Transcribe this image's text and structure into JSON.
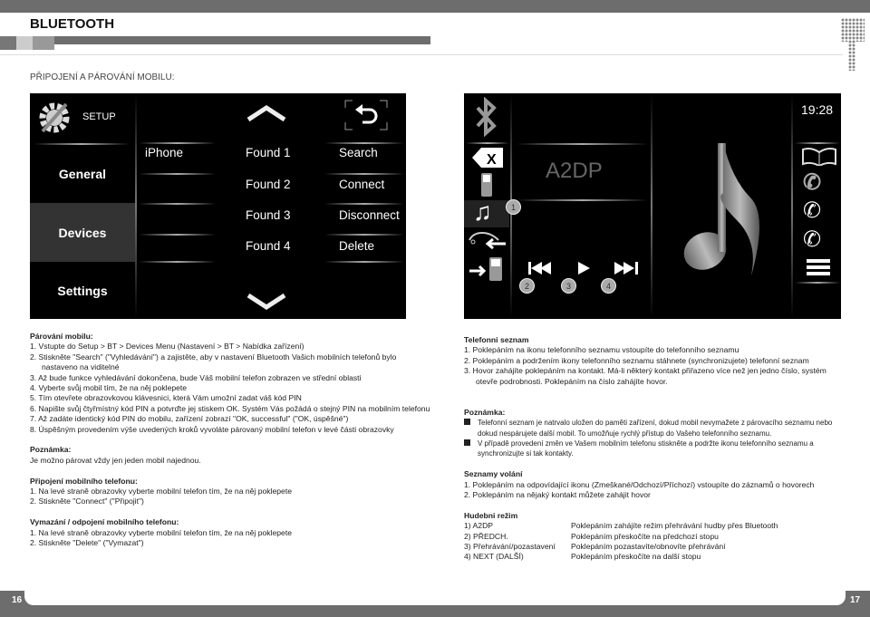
{
  "header": {
    "title": "BLUETOOTH",
    "subtitle": "PŘIPOJENÍ A PÁROVÁNÍ MOBILU:"
  },
  "setup_screen": {
    "setup_label": "SETUP",
    "menu": [
      "General",
      "Devices",
      "Settings"
    ],
    "selected_menu": "Devices",
    "paired": [
      "iPhone"
    ],
    "found": [
      "Found 1",
      "Found 2",
      "Found 3",
      "Found 4"
    ],
    "actions": [
      "Search",
      "Connect",
      "Disconnect",
      "Delete"
    ]
  },
  "music_screen": {
    "time": "19:28",
    "mode": "A2DP",
    "callouts": [
      "1",
      "2",
      "3",
      "4"
    ]
  },
  "left_text": {
    "pairing_title": "Párování mobilu:",
    "pairing_steps": [
      "1.  Vstupte do Setup > BT > Devices Menu (Nastavení > BT > Nabídka zařízení)",
      "2.  Stiskněte \"Search\" (\"Vyhledávání\") a zajistěte, aby v nastavení Bluetooth Vašich mobilních telefonů bylo nastaveno na viditelné",
      "3.  Až bude funkce vyhledávání dokončena, bude Váš mobilní telefon zobrazen ve střední oblasti",
      "4.  Vyberte svůj mobil tím, že na něj poklepete",
      "5.  Tím otevřete obrazovkovou klávesnici, která Vám umožní zadat váš kód PIN",
      "6.  Napište svůj čtyřmístný kód PIN a potvrďte jej stiskem OK. Systém Vás požádá o stejný PIN na mobilním telefonu",
      "7.  Až zadáte identický kód PIN do mobilu, zařízení zobrazí \"OK, successful\" (\"OK, úspěšné\")",
      "8.  Úspěšným provedením výše uvedených kroků vyvoláte párovaný mobilní telefon v levé části obrazovky"
    ],
    "note_title": "Poznámka:",
    "note_text": "Je možno párovat vždy jen jeden mobil najednou.",
    "connect_title": "Připojení mobilního telefonu:",
    "connect_steps": [
      "1.  Na levé straně obrazovky vyberte mobilní telefon tím, že na něj poklepete",
      "2.  Stiskněte \"Connect\" (\"Připojit\")"
    ],
    "delete_title": "Vymazání / odpojení mobilního telefonu:",
    "delete_steps": [
      "1.  Na levé straně obrazovky vyberte mobilní telefon tím, že na něj poklepete",
      "2.  Stiskněte \"Delete\" (\"Vymazat\")"
    ]
  },
  "right_text": {
    "phonebook_title": "Telefonni seznam",
    "phonebook_steps": [
      "1.  Poklepáním na ikonu telefonního seznamu vstoupíte do telefonního seznamu",
      "2.  Poklepáním a podržením ikony telefonního seznamu stáhnete (synchronizujete) telefonní seznam",
      "3.  Hovor zahájíte poklepáním na kontakt. Má-li některý kontakt přiřazeno více než jen jedno číslo, systém otevře podrobnosti. Poklepáním na číslo zahájíte hovor."
    ],
    "note_title": "Poznámka:",
    "note_bullets": [
      "Telefonní seznam je natrvalo uložen do paměti zařízení, dokud mobil nevymažete z párovacího seznamu nebo dokud nespárujete další mobil. To umožňuje rychlý přístup do Vašeho telefonního seznamu.",
      "V případě provedení změn ve Vašem mobilním telefonu stiskněte a podržte ikonu telefonního seznamu a synchronizujte si tak kontakty."
    ],
    "calllog_title": "Seznamy volání",
    "calllog_steps": [
      "1.  Poklepáním na odpovídající ikonu (Zmeškané/Odchozí/Příchozí) vstoupíte do záznamů o hovorech",
      "2.  Poklepáním na nějaký kontakt můžete zahájit hovor"
    ],
    "music_title": "Hudebni režim",
    "music_rows": [
      {
        "label": "1)  A2DP",
        "desc": "Poklepáním zahájíte režim přehrávání hudby přes Bluetooth"
      },
      {
        "label": "2)  PŘEDCH.",
        "desc": "Poklepáním přeskočíte na předchozí stopu"
      },
      {
        "label": "3)  Přehrávání/pozastavení",
        "desc": "Poklepáním pozastavíte/obnovíte přehrávání"
      },
      {
        "label": "4)  NEXT (DALŠÍ)",
        "desc": "Poklepáním přeskočíte na další stopu"
      }
    ]
  },
  "footer": {
    "page_left": "16",
    "page_right": "17"
  }
}
